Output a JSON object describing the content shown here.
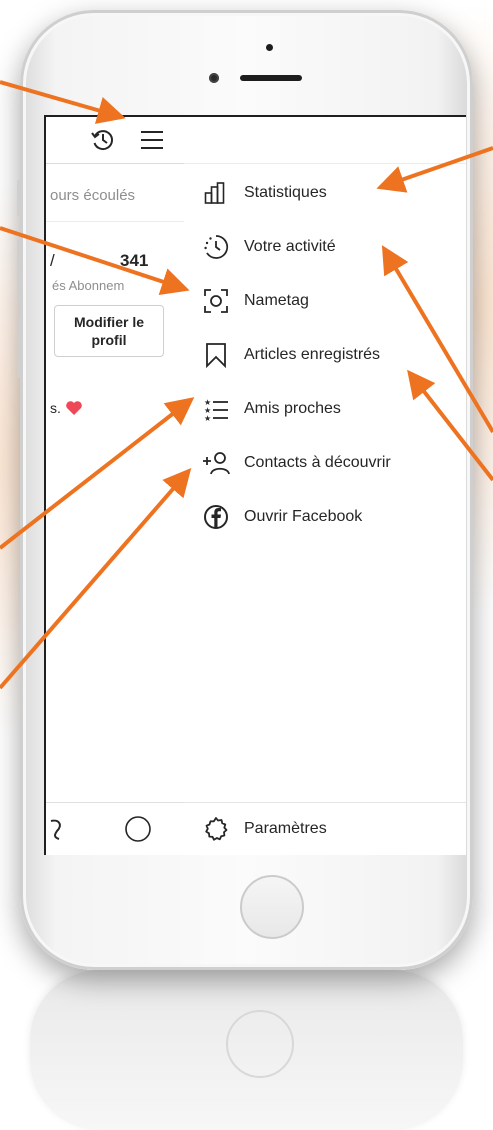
{
  "profile": {
    "story_text": "ours écoulés",
    "stat_slash": "/",
    "following_count": "341",
    "count_labels": "és Abonnem",
    "edit_button": "Modifier le profil",
    "bio_text": "s."
  },
  "menu": {
    "items": [
      {
        "label": "Statistiques",
        "icon": "bar-chart-icon"
      },
      {
        "label": "Votre activité",
        "icon": "activity-clock-icon"
      },
      {
        "label": "Nametag",
        "icon": "nametag-icon"
      },
      {
        "label": "Articles enregistrés",
        "icon": "bookmark-icon"
      },
      {
        "label": "Amis proches",
        "icon": "close-friends-list-icon"
      },
      {
        "label": "Contacts à découvrir",
        "icon": "add-person-icon"
      },
      {
        "label": "Ouvrir Facebook",
        "icon": "facebook-icon"
      }
    ],
    "settings_label": "Paramètres",
    "settings_icon": "gear-icon"
  },
  "colors": {
    "arrow": "#EE7320",
    "heart": "#ED4956",
    "text": "#262626",
    "muted": "#8E8E8E"
  }
}
